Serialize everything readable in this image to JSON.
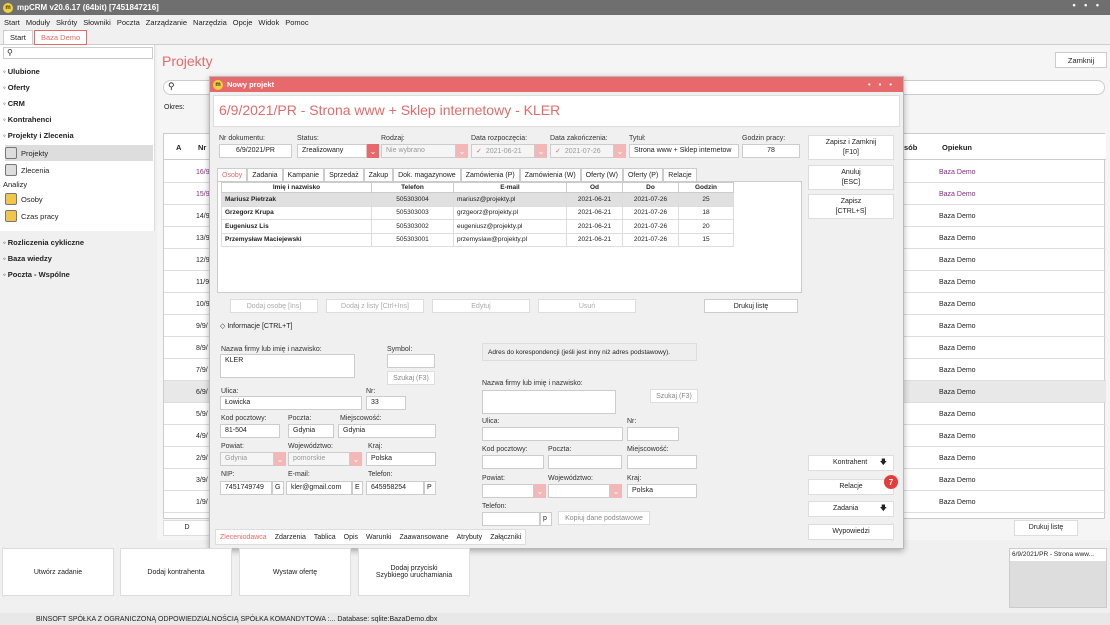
{
  "app": {
    "title": "mpCRM v20.6.17 (64bit) [7451847216]",
    "window_controls": "• • •"
  },
  "menu": [
    "Start",
    "Moduły",
    "Skróty",
    "Słowniki",
    "Poczta",
    "Zarządzanie",
    "Narzędzia",
    "Opcje",
    "Widok",
    "Pomoc"
  ],
  "tabs": [
    "Start",
    "Baza Demo"
  ],
  "sidebar": {
    "search_icon": "⚲",
    "sections": [
      "Ulubione",
      "Oferty",
      "CRM",
      "Kontrahenci",
      "Projekty i Zlecenia"
    ],
    "items": [
      "Projekty",
      "Zlecenia"
    ],
    "analizy": "Analizy",
    "analizy_items": [
      "Osoby",
      "Czas pracy"
    ],
    "sections2": [
      "Rozliczenia cykliczne",
      "Baza wiedzy",
      "Poczta - Wspólne"
    ]
  },
  "background": {
    "title": "Projekty",
    "close": "Zamknij",
    "okres": "Okres:",
    "col_a": "A",
    "col_nr": "Nr",
    "col_sob": "sób",
    "col_opiekun": "Opiekun",
    "rows": [
      {
        "nr": "16/9",
        "op": "Baza Demo"
      },
      {
        "nr": "15/9",
        "op": "Baza Demo"
      },
      {
        "nr": "14/9",
        "op": "Baza Demo"
      },
      {
        "nr": "13/9",
        "op": "Baza Demo"
      },
      {
        "nr": "12/9",
        "op": "Baza Demo"
      },
      {
        "nr": "11/9",
        "op": "Baza Demo"
      },
      {
        "nr": "10/9",
        "op": "Baza Demo"
      },
      {
        "nr": "9/9/",
        "op": "Baza Demo"
      },
      {
        "nr": "8/9/",
        "op": "Baza Demo"
      },
      {
        "nr": "7/9/",
        "op": "Baza Demo"
      },
      {
        "nr": "6/9/",
        "op": "Baza Demo"
      },
      {
        "nr": "5/9/",
        "op": "Baza Demo"
      },
      {
        "nr": "4/9/",
        "op": "Baza Demo"
      },
      {
        "nr": "2/9/",
        "op": "Baza Demo"
      },
      {
        "nr": "3/9/",
        "op": "Baza Demo"
      },
      {
        "nr": "1/9/",
        "op": "Baza Demo"
      }
    ],
    "print": "Drukuj listę",
    "d_btn": "D"
  },
  "modal": {
    "title": "Nowy projekt",
    "heading": "6/9/2021/PR - Strona www + Sklep internetowy - KLER",
    "labels": {
      "nr": "Nr dokumentu:",
      "status": "Status:",
      "rodzaj": "Rodzaj:",
      "start": "Data rozpoczęcia:",
      "end": "Data zakończenia:",
      "tytul": "Tytuł:",
      "godzin": "Godzin pracy:"
    },
    "values": {
      "nr": "6/9/2021/PR",
      "status": "Zrealizowany",
      "rodzaj": "Nie wybrano",
      "start": "2021-06-21",
      "end": "2021-07-26",
      "tytul": "Strona www + Sklep internetow",
      "godzin": "78"
    },
    "side_buttons": [
      "Zapisz i Zamknij\n[F10]",
      "Anuluj\n[ESC]",
      "Zapisz\n[CTRL+S]"
    ],
    "subtabs": [
      "Osoby",
      "Zadania",
      "Kampanie",
      "Sprzedaż",
      "Zakup",
      "Dok. magazynowe",
      "Zamówienia (P)",
      "Zamówienia (W)",
      "Oferty (W)",
      "Oferty (P)",
      "Relacje"
    ],
    "grid_headers": [
      "Imię i nazwisko",
      "Telefon",
      "E-mail",
      "Od",
      "Do",
      "Godzin"
    ],
    "grid_rows": [
      [
        "Mariusz Pietrzak",
        "505303004",
        "mariusz@projekty.pl",
        "2021-06-21",
        "2021-07-26",
        "25"
      ],
      [
        "Grzegorz Krupa",
        "505303003",
        "grzgeorz@projekty.pl",
        "2021-06-21",
        "2021-07-26",
        "18"
      ],
      [
        "Eugeniusz Lis",
        "505303002",
        "eugeniusz@projekty.pl",
        "2021-06-21",
        "2021-07-26",
        "20"
      ],
      [
        "Przemysław Maciejewski",
        "505303001",
        "przemyslaw@projekty.pl",
        "2021-06-21",
        "2021-07-26",
        "15"
      ]
    ],
    "grid_buttons": [
      "Dodaj osobę [Ins]",
      "Dodaj z listy [Ctrl+Ins]",
      "Edytuj",
      "Usuń",
      "Drukuj listę"
    ],
    "info_header": "Informacje [CTRL+T]",
    "left": {
      "firma_lbl": "Nazwa firmy lub imię i nazwisko:",
      "firma": "KLER",
      "symbol_lbl": "Symbol:",
      "szukaj": "Szukaj (F3)",
      "ulica_lbl": "Ulica:",
      "ulica": "Łowicka",
      "nr_lbl": "Nr:",
      "nr": "33",
      "kod_lbl": "Kod pocztowy:",
      "kod": "81-504",
      "poczta_lbl": "Poczta:",
      "poczta": "Gdynia",
      "miejsc_lbl": "Miejscowość:",
      "miejsc": "Gdynia",
      "powiat_lbl": "Powiat:",
      "powiat": "Gdynia",
      "woj_lbl": "Województwo:",
      "woj": "pomorskie",
      "kraj_lbl": "Kraj:",
      "kraj": "Polska",
      "nip_lbl": "NIP:",
      "nip": "7451749749",
      "g": "G",
      "email_lbl": "E-mail:",
      "email": "kler@gmail.com",
      "e": "E",
      "tel_lbl": "Telefon:",
      "tel": "645958254",
      "p": "P"
    },
    "right": {
      "note": "Adres do korespondencji (jeśli jest inny niż adres podstawowy).",
      "firma_lbl": "Nazwa firmy lub imię i nazwisko:",
      "szukaj": "Szukaj (F3)",
      "ulica_lbl": "Ulica:",
      "nr_lbl": "Nr:",
      "kod_lbl": "Kod pocztowy:",
      "poczta_lbl": "Poczta:",
      "miejsc_lbl": "Miejscowość:",
      "powiat_lbl": "Powiat:",
      "woj_lbl": "Województwo:",
      "kraj_lbl": "Kraj:",
      "kraj": "Polska",
      "tel_lbl": "Telefon:",
      "p": "p",
      "kopiuj": "Kopiuj dane podstawowe"
    },
    "right_buttons": [
      "Kontrahent",
      "Relacje",
      "Zadania",
      "Wypowiedzi"
    ],
    "badge": "7",
    "bottom_tabs": [
      "Zleceniodawca",
      "Zdarzenia",
      "Tablica",
      "Opis",
      "Warunki",
      "Zaawansowane",
      "Atrybuty",
      "Załączniki"
    ]
  },
  "quick": [
    "Utwórz zadanie",
    "Dodaj kontrahenta",
    "Wystaw ofertę",
    "Dodaj przyciski\nSzybkiego uruchamiania"
  ],
  "thumbnail": "6/9/2021/PR - Strona www...",
  "status": "BINSOFT SPÓŁKA Z OGRANICZONĄ ODPOWIEDZIALNOŚCIĄ SPÓŁKA KOMANDYTOWA :... Database: sqlite:BazaDemo.dbx"
}
